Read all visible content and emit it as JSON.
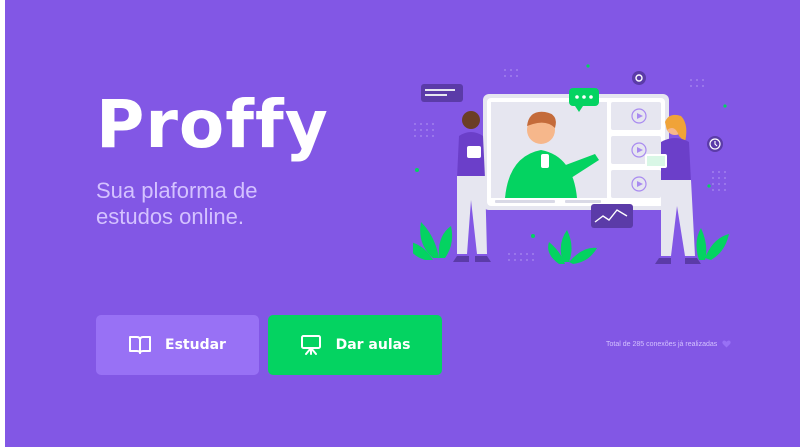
{
  "brand": {
    "name": "Proffy",
    "tagline_line1": "Sua plaforma de",
    "tagline_line2": "estudos online."
  },
  "buttons": {
    "study_label": "Estudar",
    "teach_label": "Dar aulas",
    "study_icon": "book-open-icon",
    "teach_icon": "presentation-board-icon"
  },
  "footer": {
    "connections_text": "Total de 285 conexões já realizadas",
    "connections_icon": "heart-icon"
  },
  "colors": {
    "primary": "#8257e5",
    "primary_light": "#9871f5",
    "secondary": "#04d361",
    "text_light": "#d4c2ff"
  }
}
